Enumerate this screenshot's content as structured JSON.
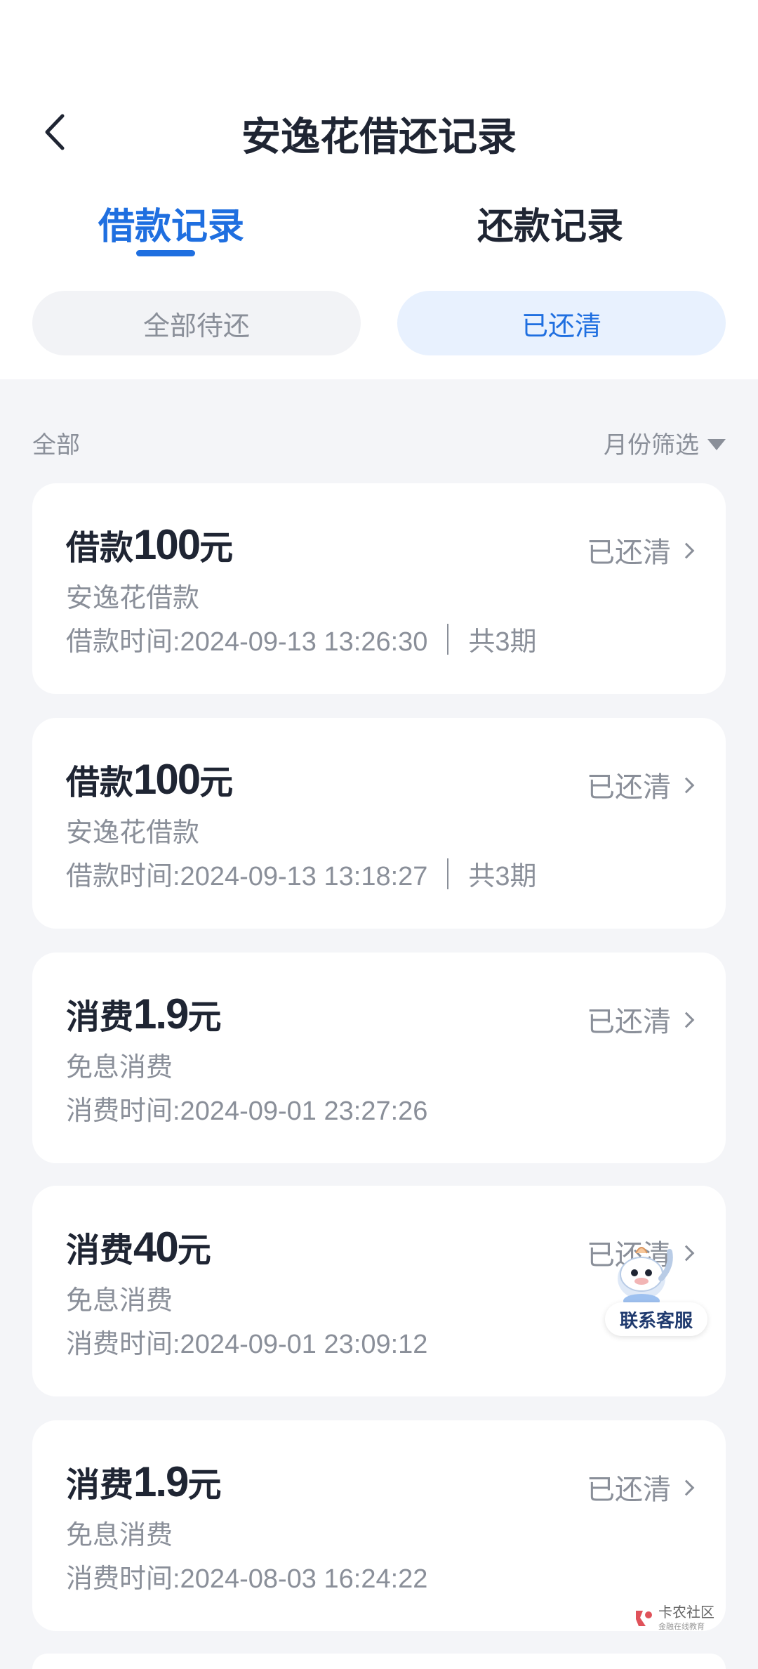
{
  "header": {
    "title": "安逸花借还记录"
  },
  "tabs": [
    {
      "label": "借款记录",
      "active": true
    },
    {
      "label": "还款记录",
      "active": false
    }
  ],
  "filters": [
    {
      "label": "全部待还",
      "selected": false
    },
    {
      "label": "已还清",
      "selected": true
    }
  ],
  "list_header": {
    "left": "全部",
    "right": "月份筛选"
  },
  "records": [
    {
      "type": "借款",
      "amount": "100",
      "unit": "元",
      "status": "已还清",
      "product": "安逸花借款",
      "time_label": "借款时间:2024-09-13 13:26:30",
      "installments": "共3期"
    },
    {
      "type": "借款",
      "amount": "100",
      "unit": "元",
      "status": "已还清",
      "product": "安逸花借款",
      "time_label": "借款时间:2024-09-13 13:18:27",
      "installments": "共3期"
    },
    {
      "type": "消费",
      "amount": "1.9",
      "unit": "元",
      "status": "已还清",
      "product": "免息消费",
      "time_label": "消费时间:2024-09-01 23:27:26",
      "installments": ""
    },
    {
      "type": "消费",
      "amount": "40",
      "unit": "元",
      "status": "已还清",
      "product": "免息消费",
      "time_label": "消费时间:2024-09-01 23:09:12",
      "installments": ""
    },
    {
      "type": "消费",
      "amount": "1.9",
      "unit": "元",
      "status": "已还清",
      "product": "免息消费",
      "time_label": "消费时间:2024-08-03 16:24:22",
      "installments": ""
    }
  ],
  "customer_service": {
    "label": "联系客服"
  },
  "watermark": {
    "text": "卡农社区",
    "sub": "金融在线教育"
  },
  "colors": {
    "accent": "#1f6fe0",
    "text": "#1f2533",
    "muted": "#8a8f99",
    "bg": "#f4f5f8"
  }
}
